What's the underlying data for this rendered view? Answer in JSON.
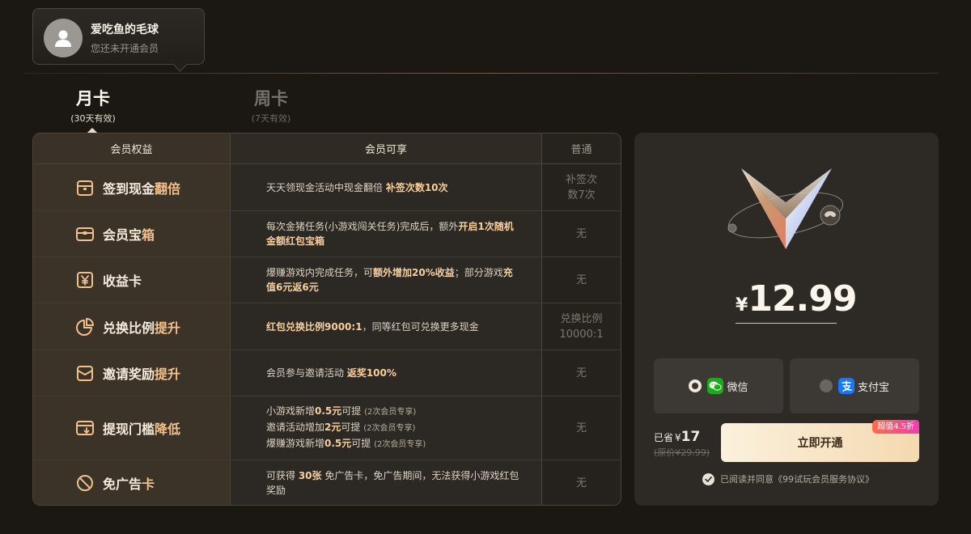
{
  "user": {
    "name": "爱吃鱼的毛球",
    "status": "您还未开通会员"
  },
  "tabs": [
    {
      "title": "月卡",
      "sub": "(30天有效)",
      "active": true
    },
    {
      "title": "周卡",
      "sub": "(7天有效)",
      "active": false
    }
  ],
  "table": {
    "headers": [
      "会员权益",
      "会员可享",
      "普通"
    ],
    "rows": [
      {
        "icon": "calendar-icon",
        "name": "签到现金",
        "name_hl": "翻倍",
        "desc": [
          {
            "t": "天天领现金活动中现金翻倍 "
          },
          {
            "t": "补签次数10次",
            "hl": true
          }
        ],
        "normal": [
          "补签次",
          "数7次"
        ]
      },
      {
        "icon": "treasure-chest-icon",
        "name": "会员宝",
        "name_hl": "箱",
        "desc": [
          {
            "t": "每次金猪任务(小游戏闯关任务)完成后，额外"
          },
          {
            "t": "开启1次随机金额红包宝箱",
            "hl": true
          }
        ],
        "normal": [
          "无"
        ]
      },
      {
        "icon": "yen-card-icon",
        "name": "收益卡",
        "name_hl": "",
        "desc": [
          {
            "t": "爆赚游戏内完成任务，可"
          },
          {
            "t": "额外增加20%收益",
            "hl": true
          },
          {
            "t": "；部分游戏"
          },
          {
            "t": "充值6元返6元",
            "hl": true
          }
        ],
        "normal": [
          "无"
        ]
      },
      {
        "icon": "pie-chart-icon",
        "name": "兑换比例",
        "name_hl": "提升",
        "desc": [
          {
            "t": "红包兑换比例9000:1",
            "hl": true
          },
          {
            "t": "，同等红包可兑换更多现金"
          }
        ],
        "normal": [
          "兑换比例",
          "10000:1"
        ]
      },
      {
        "icon": "envelope-icon",
        "name": "邀请奖励",
        "name_hl": "提升",
        "desc": [
          {
            "t": "会员参与邀请活动 "
          },
          {
            "t": "返奖100%",
            "hl": true
          }
        ],
        "normal": [
          "无"
        ]
      },
      {
        "icon": "withdraw-icon",
        "name": "提现门槛",
        "name_hl": "降低",
        "desc_lines": [
          [
            {
              "t": "小游戏新增"
            },
            {
              "t": "0.5元",
              "hl": true
            },
            {
              "t": "可提 "
            },
            {
              "t": " (2次会员专享)",
              "note": true
            }
          ],
          [
            {
              "t": "邀请活动增加"
            },
            {
              "t": "2元",
              "hl": true
            },
            {
              "t": "可提 "
            },
            {
              "t": " (2次会员专享)",
              "note": true
            }
          ],
          [
            {
              "t": "爆赚游戏新增"
            },
            {
              "t": "0.5元",
              "hl": true
            },
            {
              "t": "可提 "
            },
            {
              "t": " (2次会员专享)",
              "note": true
            }
          ]
        ],
        "normal": [
          "无"
        ]
      },
      {
        "icon": "no-ads-icon",
        "name": "免广告",
        "name_hl": "卡",
        "desc": [
          {
            "t": "可获得 "
          },
          {
            "t": "30张",
            "hl": true
          },
          {
            "t": " 免广告卡，免广告期间，无法获得小游戏红包奖励"
          }
        ],
        "normal": [
          "无"
        ]
      }
    ]
  },
  "purchase": {
    "currency": "¥",
    "price": "12.99",
    "pay_methods": [
      {
        "label": "微信",
        "selected": true
      },
      {
        "label": "支付宝",
        "selected": false
      }
    ],
    "saved_prefix": "已省",
    "saved_currency": "¥",
    "saved_amount": "17",
    "original_price": "(原价¥29.99)",
    "open_button": "立即开通",
    "discount_badge": "超值4.5折",
    "agreement": "已阅读并同意《99试玩会员服务协议》"
  },
  "colors": {
    "background": "#1b1813",
    "highlight": "#f2c08d",
    "button_gradient": [
      "#fbf1dd",
      "#f4d9b0"
    ],
    "badge_gradient": [
      "#ff6a4a",
      "#ec3fb0"
    ],
    "wechat": "#1aad19",
    "alipay": "#1677ff"
  }
}
